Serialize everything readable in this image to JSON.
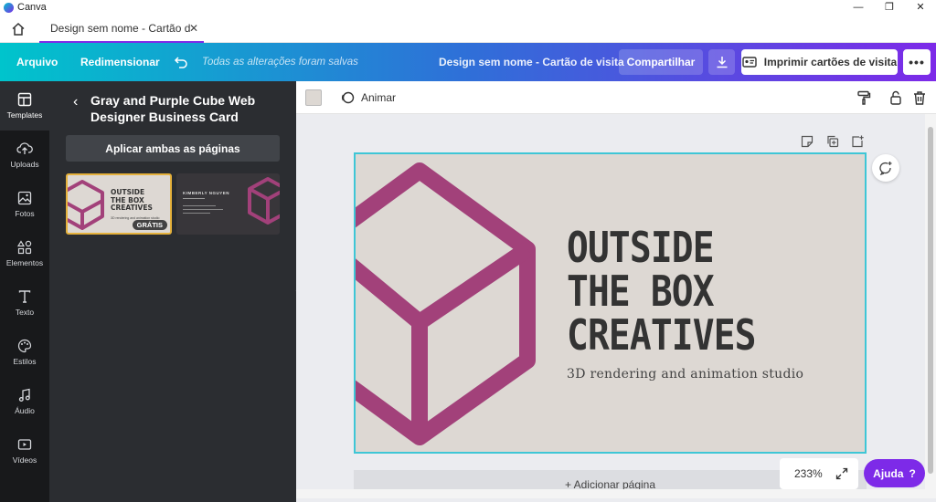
{
  "window": {
    "app_name": "Canva",
    "minimize": "—",
    "maximize": "❐",
    "close": "✕"
  },
  "tab": {
    "label": "Design sem nome - Cartão d",
    "close": "✕"
  },
  "topbar": {
    "file": "Arquivo",
    "resize": "Redimensionar",
    "saved_status": "Todas as alterações foram salvas",
    "doc_title": "Design sem nome - Cartão de visita",
    "share": "Compartilhar",
    "print": "Imprimir cartões de visita",
    "more": "•••"
  },
  "rail": {
    "items": [
      {
        "label": "Templates"
      },
      {
        "label": "Uploads"
      },
      {
        "label": "Fotos"
      },
      {
        "label": "Elementos"
      },
      {
        "label": "Texto"
      },
      {
        "label": "Estilos"
      },
      {
        "label": "Áudio"
      },
      {
        "label": "Vídeos"
      }
    ]
  },
  "panel": {
    "back": "‹",
    "title": "Gray and Purple Cube Web Designer Business Card",
    "apply": "Aplicar ambas as páginas",
    "thumb1": {
      "title": "OUTSIDE\nTHE BOX\nCREATIVES",
      "subtitle": "3D rendering and animation studio",
      "badge": "GRÁTIS"
    },
    "thumb2": {
      "name": "KIMBERLY NGUYEN"
    },
    "collapse": "‹"
  },
  "editor": {
    "animate": "Animar"
  },
  "card": {
    "line1": "OUTSIDE",
    "line2": "THE BOX",
    "line3": "CREATIVES",
    "subtitle": "3D rendering and animation studio",
    "bg_color": "#ddd8d3",
    "cube_color": "#a2417a"
  },
  "canvas": {
    "add_page": "+ Adicionar página"
  },
  "zoom": {
    "level": "233%"
  },
  "help": {
    "label": "Ajuda",
    "icon": "?"
  }
}
